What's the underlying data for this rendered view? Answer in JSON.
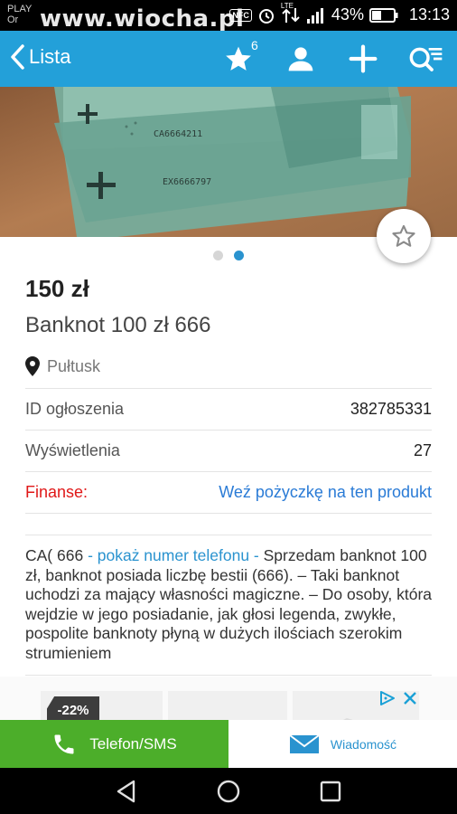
{
  "status_bar": {
    "carrier_line1": "PLAY",
    "carrier_line2": "Or",
    "watermark": "www.wiocha.pl",
    "nfc": "NFC",
    "lte": "LTE",
    "battery_percent": "43%",
    "time": "13:13"
  },
  "top_bar": {
    "back_label": "Lista",
    "favorites_count": "6",
    "icons": [
      "star-icon",
      "profile-icon",
      "plus-icon",
      "search-icon"
    ],
    "accent": "#23a0d9"
  },
  "gallery": {
    "total": 2,
    "active": 2
  },
  "listing": {
    "price": "150 zł",
    "title": "Banknot 100 zł 666",
    "location": "Pułtusk"
  },
  "details": [
    {
      "label": "ID ogłoszenia",
      "value": "382785331"
    },
    {
      "label": "Wyświetlenia",
      "value": "27"
    }
  ],
  "finance": {
    "label": "Finanse:",
    "link": "Weź pożyczkę na ten produkt"
  },
  "description": {
    "prefix": "CA( 666 ",
    "phone_link": "- pokaż numer telefonu -",
    "text": " Sprzedam banknot 100 zł, banknot posiada liczbę bestii (666). – Taki banknot uchodzi za mający własności magiczne. – Do osoby, która wejdzie w jego posiadanie, jak głosi legenda, zwykłe, pospolite banknoty płyną w dużych ilościach szerokim strumieniem"
  },
  "ad": {
    "badge": "-22%"
  },
  "actions": {
    "call_label": "Telefon/SMS",
    "message_label": "Wiadomość",
    "call_color": "#4cae2a"
  }
}
